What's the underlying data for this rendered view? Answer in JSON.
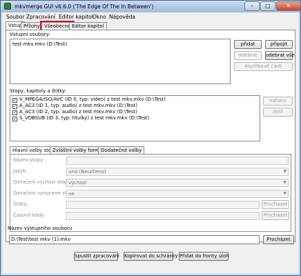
{
  "window": {
    "title": "mkvmerge GUI v6.6.0 ('The Edge Of The In Between')"
  },
  "menu": [
    "Soubor",
    "Zpracování",
    "Editor kapitol",
    "Okno",
    "Nápověda"
  ],
  "tabs": [
    "Vstup",
    "Přílohy",
    "Všeobecné",
    "Editor kapitol"
  ],
  "input": {
    "files_label": "Vstupní soubory:",
    "files": [
      "test mkv.mkv (D:\\Test)"
    ],
    "btn_add": "přidat",
    "btn_append": "připojit",
    "btn_remove": "odebrat",
    "btn_remove_all": "odebrat vše",
    "btn_additional": "doplňkové části",
    "tracks_label": "Stopy, kapitoly a štítky:",
    "tracks": [
      "V_MPEG4/ISO/AVC (ID 0, typ: video) z test mkv.mkv (D:\\Test)",
      "A_AC3 (ID 1, typ: audio) z test mkv.mkv (D:\\Test)",
      "A_AC3 (ID 2, typ: audio) z test mkv.mkv (D:\\Test)",
      "S_VOBSUB (ID 3, typ: titulky) z test mkv.mkv (D:\\Test)"
    ],
    "btn_up": "nahoru",
    "btn_down": "dolů"
  },
  "subtabs": [
    "Hlavní volby stopy",
    "Zvláštní volby formátu",
    "Dodatečné volby"
  ],
  "track_options": {
    "name_label": "Název stopy:",
    "language_label": "Jazyk:",
    "language_value": "und (Neurčeno)",
    "default_label": "Označení výchozí stopy:",
    "default_value": "výchozí",
    "forced_label": "Označení vynucené stopy:",
    "forced_value": "ne",
    "tags_label": "Štítky:",
    "timecodes_label": "Časové kódy:",
    "browse": "Procházet"
  },
  "output": {
    "label": "Název výstupního souboru",
    "value": "D:\\Test\\test mkv (1).mkv",
    "browse": "Procházet"
  },
  "actions": {
    "start": "Spustit zpracování",
    "copy": "Kopírovat do schránky",
    "queue": "Přidat do fronty úloh"
  },
  "colors": {
    "highlight": "#d8141c"
  }
}
